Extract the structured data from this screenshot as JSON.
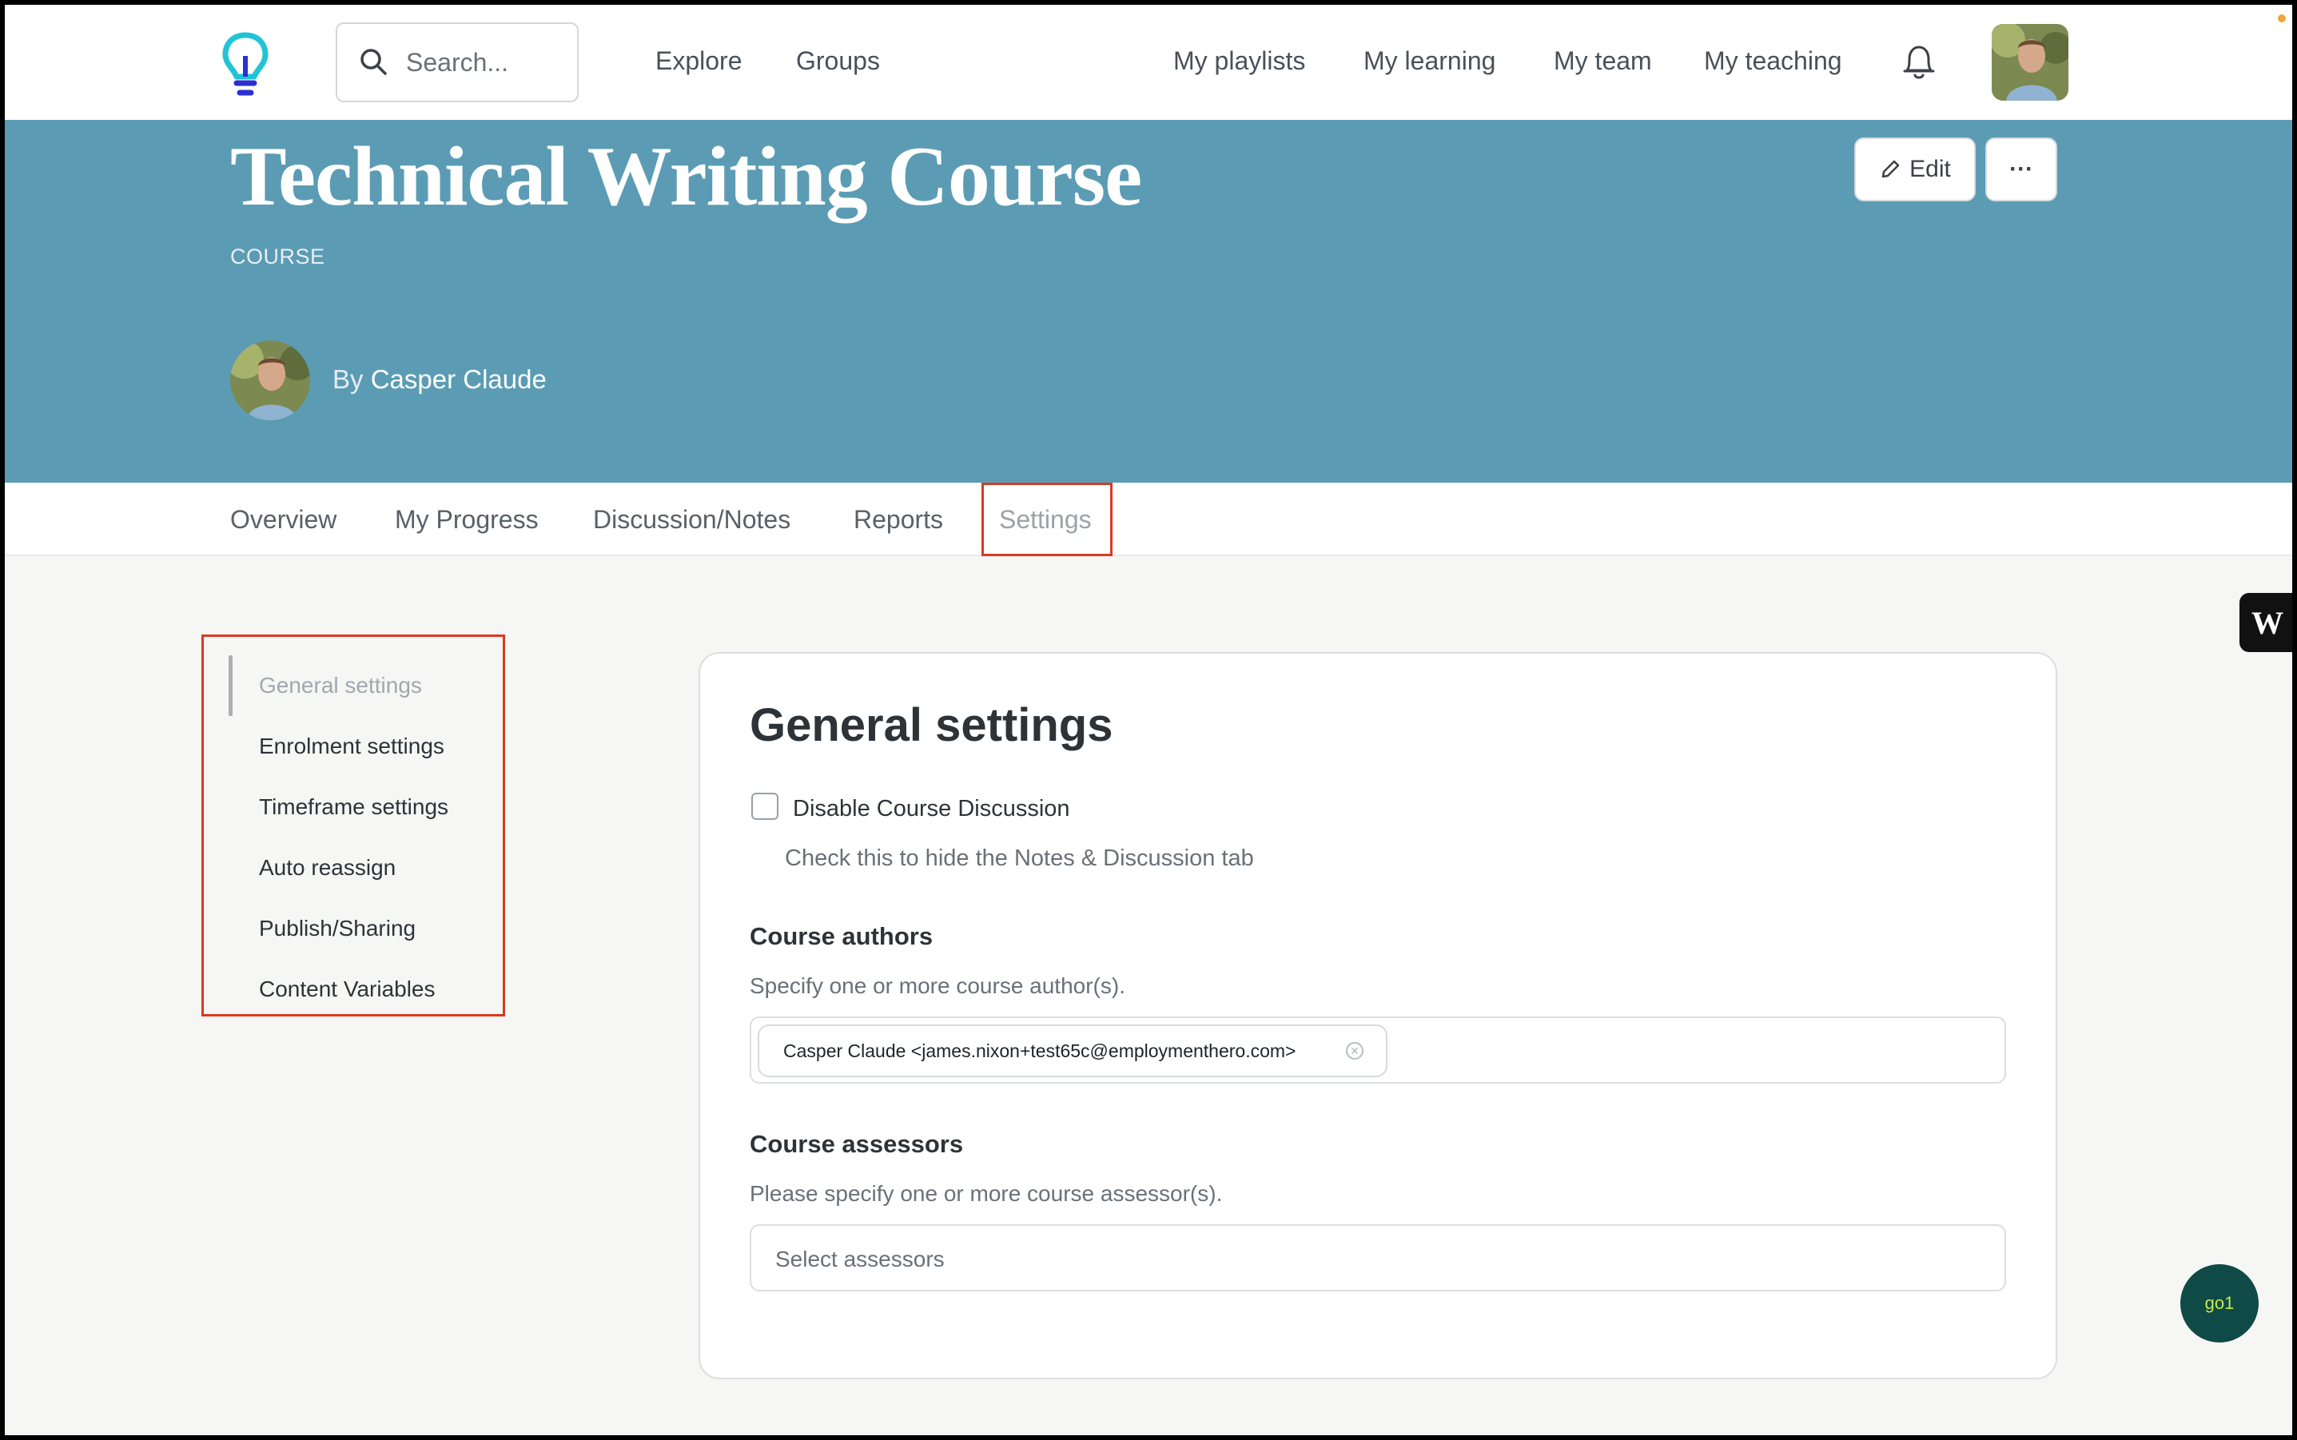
{
  "topnav": {
    "search_placeholder": "Search...",
    "links": [
      "Explore",
      "Groups",
      "My playlists",
      "My learning",
      "My team",
      "My teaching"
    ],
    "icons": [
      "lightbulb-logo",
      "search-icon",
      "bell-icon",
      "avatar"
    ]
  },
  "hero": {
    "title": "Technical Writing Course",
    "type_label": "COURSE",
    "by_prefix": "By",
    "author": "Casper Claude",
    "edit_label": "Edit",
    "more_label": "···",
    "background": "#5b9cb4"
  },
  "tabs": {
    "items": [
      "Overview",
      "My Progress",
      "Discussion/Notes",
      "Reports",
      "Settings"
    ],
    "active": "Settings"
  },
  "side_menu": {
    "items": [
      "General settings",
      "Enrolment settings",
      "Timeframe settings",
      "Auto reassign",
      "Publish/Sharing",
      "Content Variables"
    ],
    "active": "General settings"
  },
  "settings": {
    "title": "General settings",
    "disable_discussion": {
      "label": "Disable Course Discussion",
      "help": "Check this to hide the Notes & Discussion tab",
      "checked": false
    },
    "authors": {
      "heading": "Course authors",
      "description": "Specify one or more course author(s).",
      "selected": [
        "Casper Claude <james.nixon+test65c@employmenthero.com>"
      ]
    },
    "assessors": {
      "heading": "Course assessors",
      "description": "Please specify one or more course assessor(s).",
      "placeholder": "Select assessors"
    }
  },
  "widgets": {
    "w_label": "W",
    "go1_label": "go1"
  },
  "colors": {
    "accent": "#5b9cb4",
    "highlight": "#d83a22",
    "logo_teal": "#20c4d6",
    "logo_blue": "#2a2fd4",
    "go1_bg": "#0f4a47"
  }
}
